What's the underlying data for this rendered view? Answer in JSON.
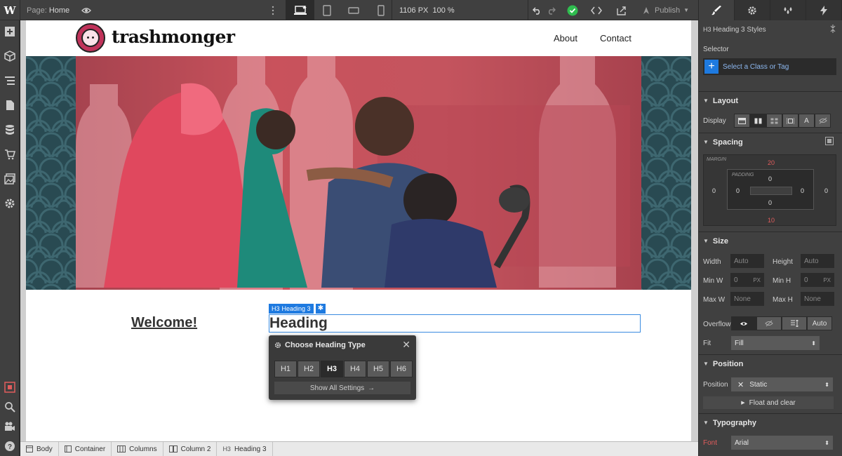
{
  "topbar": {
    "logo": "W",
    "page_label": "Page:",
    "page_name": "Home",
    "width_value": "1106 PX",
    "zoom_value": "100 %",
    "publish_label": "Publish"
  },
  "site": {
    "brand": "trashmonger",
    "nav": [
      "About",
      "Contact"
    ],
    "welcome": "Welcome!",
    "heading": "Heading"
  },
  "selection": {
    "tag": "H3",
    "label": "Heading 3"
  },
  "heading_popup": {
    "title": "Choose Heading Type",
    "types": [
      "H1",
      "H2",
      "H3",
      "H4",
      "H5",
      "H6"
    ],
    "active": "H3",
    "show_all": "Show All Settings"
  },
  "breadcrumbs": [
    {
      "icon": "body-icon",
      "label": "Body"
    },
    {
      "icon": "container-icon",
      "label": "Container"
    },
    {
      "icon": "columns-icon",
      "label": "Columns"
    },
    {
      "icon": "column-icon",
      "label": "Column 2"
    },
    {
      "icon": "heading-icon",
      "tag": "H3",
      "label": "Heading 3"
    }
  ],
  "panel": {
    "styles_tag": "H3",
    "styles_title": "Heading 3 Styles",
    "selector_label": "Selector",
    "selector_placeholder": "Select a Class or Tag",
    "layout_title": "Layout",
    "display_label": "Display",
    "display_last": "A",
    "spacing_title": "Spacing",
    "margin_label": "MARGIN",
    "padding_label": "PADDING",
    "margin_top": "20",
    "margin_bottom": "10",
    "margin_left": "0",
    "margin_right": "0",
    "padding_top": "0",
    "padding_bottom": "0",
    "padding_left": "0",
    "padding_right": "0",
    "size_title": "Size",
    "width_label": "Width",
    "width_value": "Auto",
    "height_label": "Height",
    "height_value": "Auto",
    "minw_label": "Min W",
    "minw_value": "0",
    "minw_unit": "PX",
    "minh_label": "Min H",
    "minh_value": "0",
    "minh_unit": "PX",
    "maxw_label": "Max W",
    "maxw_value": "None",
    "maxh_label": "Max H",
    "maxh_value": "None",
    "overflow_label": "Overflow",
    "overflow_auto": "Auto",
    "fit_label": "Fit",
    "fit_value": "Fill",
    "position_title": "Position",
    "position_label": "Position",
    "position_value": "Static",
    "float_label": "Float and clear",
    "typography_title": "Typography",
    "font_label": "Font",
    "font_value": "Arial"
  },
  "colors": {
    "selection_blue": "#1e7ae0",
    "brand_pink": "#c0335a",
    "margin_red": "#e05c5c",
    "success_green": "#2fbd4f"
  }
}
